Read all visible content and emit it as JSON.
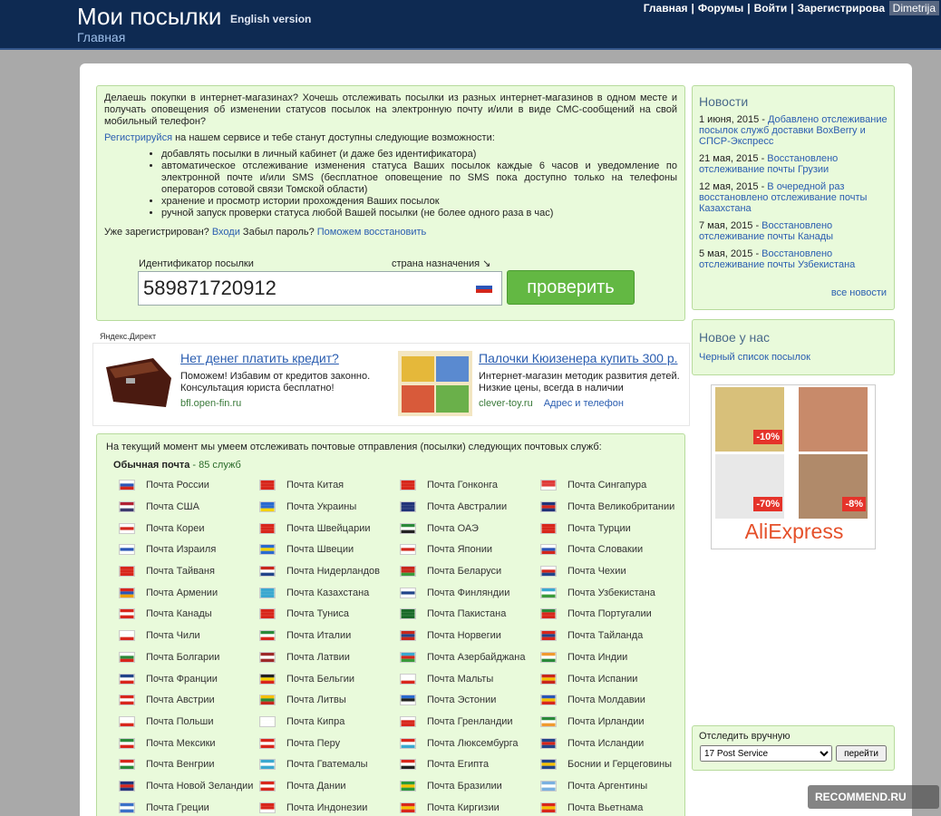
{
  "header": {
    "title": "Мои посылки",
    "english": "English version",
    "breadcrumb": "Главная",
    "nav": [
      "Главная",
      "Форумы",
      "Войти",
      "Зарегистрирова"
    ],
    "watermark": "Dimetrija"
  },
  "intro": {
    "p1": "Делаешь покупки в интернет-магазинах? Хочешь отслеживать посылки из разных интернет-магазинов в одном месте и получать оповещения об изменении статусов посылок на электронную почту и/или в виде СМС-сообщений на свой мобильный телефон?",
    "register_link": "Регистрируйся",
    "p2": " на нашем сервисе и тебе станут доступны следующие возможности:",
    "features": [
      "добавлять посылки в личный кабинет (и даже без идентификатора)",
      "автоматическое отслеживание изменения статуса Ваших посылок каждые 6 часов и уведомление по электронной почте и/или SMS (бесплатное оповещение по SMS пока доступно только на телефоны операторов сотовой связи Томской области)",
      "хранение и просмотр истории прохождения Ваших посылок",
      "ручной запуск проверки статуса любой Вашей посылки (не более одного раза в час)"
    ],
    "registered_text": "Уже зарегистрирован? ",
    "login_link": "Входи",
    "forgot_text": " Забыл пароль? ",
    "restore_link": "Поможем восстановить"
  },
  "tracker": {
    "label": "Идентификатор посылки",
    "country_label": "страна назначения ↘",
    "value": "589871720912",
    "button": "проверить"
  },
  "news": {
    "title": "Новости",
    "items": [
      {
        "date": "1 июня, 2015 - ",
        "text": "Добавлено отслеживание посылок служб доставки BoxBerry и СПСР-Экспресс"
      },
      {
        "date": "21 мая, 2015 - ",
        "text": "Восстановлено отслеживание почты Грузии"
      },
      {
        "date": "12 мая, 2015 - ",
        "text": "В очередной раз восстановлено отслеживание почты Казахстана"
      },
      {
        "date": "7 мая, 2015 - ",
        "text": "Восстановлено отслеживание почты Канады"
      },
      {
        "date": "5 мая, 2015 - ",
        "text": "Восстановлено отслеживание почты Узбекистана"
      }
    ],
    "all": "все новости"
  },
  "new_us": {
    "title": "Новое у нас",
    "link": "Черный список посылок"
  },
  "ads": {
    "label": "Яндекс.Директ",
    "ad1": {
      "title": "Нет денег платить кредит?",
      "text": "Поможем! Избавим от кредитов законно. Консультация юриста бесплатно!",
      "url": "bfl.open-fin.ru"
    },
    "ad2": {
      "title": "Палочки Кюизенера купить 300 р.",
      "text": "Интернет-магазин методик развития детей. Низкие цены, всегда в наличии",
      "url": "clever-toy.ru",
      "extra": "Адрес и телефон"
    }
  },
  "banner": {
    "d1": "-10%",
    "d2": "-70%",
    "d3": "-8%",
    "brand": "AliExpress"
  },
  "services": {
    "intro": "На текущий момент мы умеем отслеживать почтовые отправления (посылки) следующих почтовых служб:",
    "head": "Обычная почта",
    "count": " - 85 служб",
    "items": [
      {
        "n": "Почта России",
        "f": [
          "#fff",
          "#2b55b8",
          "#d3261c"
        ]
      },
      {
        "n": "Почта Китая",
        "f": [
          "#d8261c",
          "#d8261c",
          "#d8261c"
        ]
      },
      {
        "n": "Почта Гонконга",
        "f": [
          "#d8261c",
          "#d8261c",
          "#d8261c"
        ]
      },
      {
        "n": "Почта Сингапура",
        "f": [
          "#e03a3a",
          "#e03a3a",
          "#fff"
        ]
      },
      {
        "n": "Почта США",
        "f": [
          "#b22234",
          "#fff",
          "#3c3b6e"
        ]
      },
      {
        "n": "Почта Украины",
        "f": [
          "#2a6ad0",
          "#2a6ad0",
          "#f5d300"
        ]
      },
      {
        "n": "Почта Австралии",
        "f": [
          "#22347a",
          "#22347a",
          "#22347a"
        ]
      },
      {
        "n": "Почта Великобритании",
        "f": [
          "#22347a",
          "#d8261c",
          "#22347a"
        ]
      },
      {
        "n": "Почта Кореи",
        "f": [
          "#fff",
          "#d3261c",
          "#fff"
        ]
      },
      {
        "n": "Почта Швейцарии",
        "f": [
          "#d8261c",
          "#d8261c",
          "#d8261c"
        ]
      },
      {
        "n": "Почта ОАЭ",
        "f": [
          "#2a8a3a",
          "#fff",
          "#222"
        ]
      },
      {
        "n": "Почта Турции",
        "f": [
          "#d8261c",
          "#d8261c",
          "#d8261c"
        ]
      },
      {
        "n": "Почта Израиля",
        "f": [
          "#fff",
          "#2a55b8",
          "#fff"
        ]
      },
      {
        "n": "Почта Швеции",
        "f": [
          "#2a6ad0",
          "#f5d300",
          "#2a6ad0"
        ]
      },
      {
        "n": "Почта Японии",
        "f": [
          "#fff",
          "#d3261c",
          "#fff"
        ]
      },
      {
        "n": "Почта Словакии",
        "f": [
          "#fff",
          "#2b55b8",
          "#d3261c"
        ]
      },
      {
        "n": "Почта Тайваня",
        "f": [
          "#d8261c",
          "#d8261c",
          "#d8261c"
        ]
      },
      {
        "n": "Почта Нидерландов",
        "f": [
          "#c8261c",
          "#fff",
          "#22448a"
        ]
      },
      {
        "n": "Почта Беларуси",
        "f": [
          "#c8261c",
          "#c8261c",
          "#3a9a3a"
        ]
      },
      {
        "n": "Почта Чехии",
        "f": [
          "#fff",
          "#d3261c",
          "#22448a"
        ]
      },
      {
        "n": "Почта Армении",
        "f": [
          "#d8261c",
          "#2a55b8",
          "#f0a000"
        ]
      },
      {
        "n": "Почта Казахстана",
        "f": [
          "#3aa8d0",
          "#3aa8d0",
          "#3aa8d0"
        ]
      },
      {
        "n": "Почта Финляндии",
        "f": [
          "#fff",
          "#22448a",
          "#fff"
        ]
      },
      {
        "n": "Почта Узбекистана",
        "f": [
          "#3aa8d0",
          "#fff",
          "#3a9a3a"
        ]
      },
      {
        "n": "Почта Канады",
        "f": [
          "#d8261c",
          "#fff",
          "#d8261c"
        ]
      },
      {
        "n": "Почта Туниса",
        "f": [
          "#d8261c",
          "#d8261c",
          "#d8261c"
        ]
      },
      {
        "n": "Почта Пакистана",
        "f": [
          "#1a6a2a",
          "#1a6a2a",
          "#1a6a2a"
        ]
      },
      {
        "n": "Почта Португалии",
        "f": [
          "#2a8a3a",
          "#d8261c",
          "#d8261c"
        ]
      },
      {
        "n": "Почта Чили",
        "f": [
          "#fff",
          "#fff",
          "#d8261c"
        ]
      },
      {
        "n": "Почта Италии",
        "f": [
          "#2a8a3a",
          "#fff",
          "#d8261c"
        ]
      },
      {
        "n": "Почта Норвегии",
        "f": [
          "#c8261c",
          "#22448a",
          "#c8261c"
        ]
      },
      {
        "n": "Почта Тайланда",
        "f": [
          "#d8261c",
          "#22448a",
          "#d8261c"
        ]
      },
      {
        "n": "Почта Болгарии",
        "f": [
          "#fff",
          "#2a8a3a",
          "#d8261c"
        ]
      },
      {
        "n": "Почта Латвии",
        "f": [
          "#9e2a2a",
          "#fff",
          "#9e2a2a"
        ]
      },
      {
        "n": "Почта Азербайджана",
        "f": [
          "#3aa8d0",
          "#d8261c",
          "#3a9a3a"
        ]
      },
      {
        "n": "Почта Индии",
        "f": [
          "#f09a30",
          "#fff",
          "#2a8a3a"
        ]
      },
      {
        "n": "Почта Франции",
        "f": [
          "#22448a",
          "#fff",
          "#d8261c"
        ]
      },
      {
        "n": "Почта Бельгии",
        "f": [
          "#222",
          "#f5d300",
          "#d8261c"
        ]
      },
      {
        "n": "Почта Мальты",
        "f": [
          "#fff",
          "#fff",
          "#d8261c"
        ]
      },
      {
        "n": "Почта Испании",
        "f": [
          "#c8261c",
          "#f5c000",
          "#c8261c"
        ]
      },
      {
        "n": "Почта Австрии",
        "f": [
          "#d8261c",
          "#fff",
          "#d8261c"
        ]
      },
      {
        "n": "Почта Литвы",
        "f": [
          "#f5c000",
          "#2a8a3a",
          "#c8261c"
        ]
      },
      {
        "n": "Почта Эстонии",
        "f": [
          "#2a6ad0",
          "#222",
          "#fff"
        ]
      },
      {
        "n": "Почта Молдавии",
        "f": [
          "#2a55b8",
          "#f5c000",
          "#d8261c"
        ]
      },
      {
        "n": "Почта Польши",
        "f": [
          "#fff",
          "#fff",
          "#d8261c"
        ]
      },
      {
        "n": "Почта Кипра",
        "f": [
          "#fff",
          "#fff",
          "#fff"
        ]
      },
      {
        "n": "Почта Гренландии",
        "f": [
          "#fff",
          "#d8261c",
          "#d8261c"
        ]
      },
      {
        "n": "Почта Ирландии",
        "f": [
          "#2a8a3a",
          "#fff",
          "#f09a30"
        ]
      },
      {
        "n": "Почта Мексики",
        "f": [
          "#2a8a3a",
          "#fff",
          "#d8261c"
        ]
      },
      {
        "n": "Почта Перу",
        "f": [
          "#d8261c",
          "#fff",
          "#d8261c"
        ]
      },
      {
        "n": "Почта Люксембурга",
        "f": [
          "#d8261c",
          "#fff",
          "#3aa8d0"
        ]
      },
      {
        "n": "Почта Исландии",
        "f": [
          "#22448a",
          "#d8261c",
          "#22448a"
        ]
      },
      {
        "n": "Почта Венгрии",
        "f": [
          "#d8261c",
          "#fff",
          "#2a8a3a"
        ]
      },
      {
        "n": "Почта Гватемалы",
        "f": [
          "#3aa8d0",
          "#fff",
          "#3aa8d0"
        ]
      },
      {
        "n": "Почта Египта",
        "f": [
          "#d8261c",
          "#fff",
          "#222"
        ]
      },
      {
        "n": "Боснии и Герцеговины",
        "f": [
          "#22448a",
          "#f5c000",
          "#22448a"
        ]
      },
      {
        "n": "Почта Новой Зеландии",
        "f": [
          "#22347a",
          "#d8261c",
          "#22347a"
        ]
      },
      {
        "n": "Почта Дании",
        "f": [
          "#d8261c",
          "#fff",
          "#d8261c"
        ]
      },
      {
        "n": "Почта Бразилии",
        "f": [
          "#2a9a3a",
          "#f5c000",
          "#2a9a3a"
        ]
      },
      {
        "n": "Почта Аргентины",
        "f": [
          "#7ab0e0",
          "#fff",
          "#7ab0e0"
        ]
      },
      {
        "n": "Почта Греции",
        "f": [
          "#3a70c8",
          "#fff",
          "#3a70c8"
        ]
      },
      {
        "n": "Почта Индонезии",
        "f": [
          "#d8261c",
          "#d8261c",
          "#fff"
        ]
      },
      {
        "n": "Почта Киргизии",
        "f": [
          "#d8261c",
          "#f5c000",
          "#d8261c"
        ]
      },
      {
        "n": "Почта Вьетнама",
        "f": [
          "#d8261c",
          "#f5c000",
          "#d8261c"
        ]
      }
    ]
  },
  "manual": {
    "title": "Отследить вручную",
    "selected": "17 Post Service",
    "button": "перейти"
  },
  "watermark2": "RECOMMEND.RU"
}
